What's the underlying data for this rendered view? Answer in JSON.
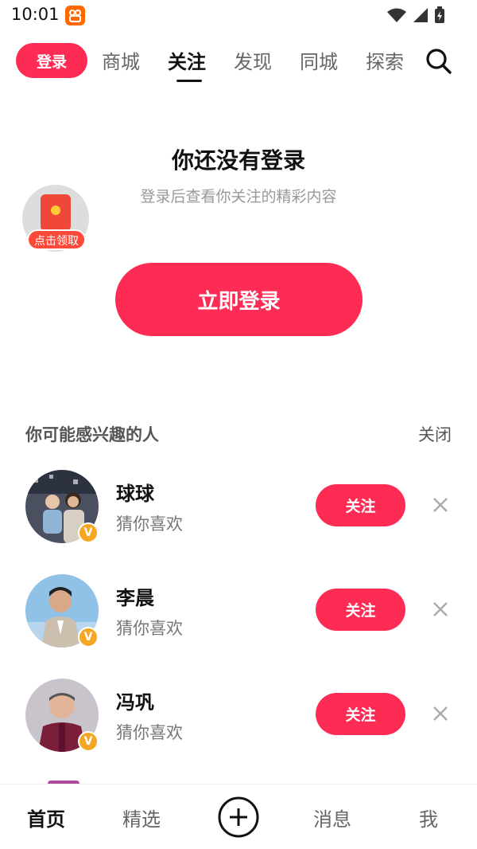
{
  "status_bar": {
    "time": "10:01",
    "app_badge_icon": "app-notification-icon"
  },
  "top_nav": {
    "login_label": "登录",
    "tabs": [
      {
        "label": "商城",
        "active": false
      },
      {
        "label": "关注",
        "active": true
      },
      {
        "label": "发现",
        "active": false
      },
      {
        "label": "同城",
        "active": false
      },
      {
        "label": "探索",
        "active": false
      }
    ],
    "search_icon": "search-icon"
  },
  "login_section": {
    "title": "你还没有登录",
    "subtitle": "登录后查看你关注的精彩内容",
    "redpack_label": "点击领取",
    "login_button": "立即登录"
  },
  "suggestions": {
    "header": "你可能感兴趣的人",
    "close_label": "关闭",
    "people": [
      {
        "name": "球球",
        "reason": "猜你喜欢",
        "follow_label": "关注",
        "verified": "V"
      },
      {
        "name": "李晨",
        "reason": "猜你喜欢",
        "follow_label": "关注",
        "verified": "V"
      },
      {
        "name": "冯巩",
        "reason": "猜你喜欢",
        "follow_label": "关注",
        "verified": "V"
      }
    ]
  },
  "bottom_nav": {
    "items": [
      {
        "label": "首页",
        "active": true
      },
      {
        "label": "精选",
        "active": false
      },
      {
        "label": "消息",
        "active": false
      },
      {
        "label": "我",
        "active": false
      }
    ]
  },
  "colors": {
    "accent": "#fe2c55",
    "verified": "#f5a623"
  }
}
